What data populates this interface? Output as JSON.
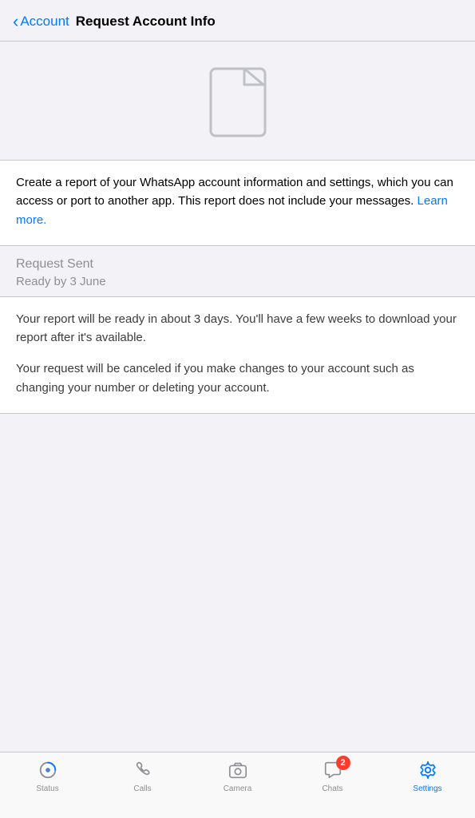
{
  "nav": {
    "back_label": "Account",
    "title": "Request Account Info"
  },
  "description": {
    "text": "Create a report of your WhatsApp account information and settings, which you can access or port to another app. This report does not include your messages.",
    "learn_more": "Learn more."
  },
  "request_status": {
    "title": "Request Sent",
    "ready_date": "Ready by 3 June"
  },
  "info_paragraphs": {
    "p1": "Your report will be ready in about 3 days. You'll have a few weeks to download your report after it's available.",
    "p2": "Your request will be canceled if you make changes to your account such as changing your number or deleting your account."
  },
  "tab_bar": {
    "items": [
      {
        "id": "status",
        "label": "Status",
        "active": false
      },
      {
        "id": "calls",
        "label": "Calls",
        "active": false
      },
      {
        "id": "camera",
        "label": "Camera",
        "active": false
      },
      {
        "id": "chats",
        "label": "Chats",
        "active": false,
        "badge": "2"
      },
      {
        "id": "settings",
        "label": "Settings",
        "active": true
      }
    ]
  },
  "colors": {
    "accent": "#007aff",
    "inactive": "#8e8e93",
    "settings_active": "#007aff"
  }
}
